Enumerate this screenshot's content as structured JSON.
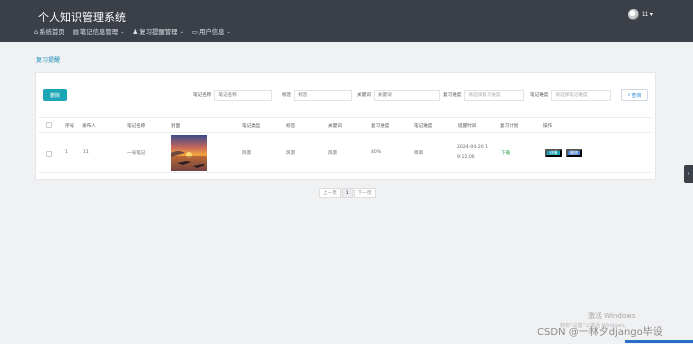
{
  "app": {
    "title": "个人知识管理系统",
    "user": "11 ▾"
  },
  "nav": [
    {
      "icon": "⌂",
      "label": "系统首页",
      "chev": ""
    },
    {
      "icon": "▤",
      "label": "笔记信息管理",
      "chev": "⌄"
    },
    {
      "icon": "♟",
      "label": "复习提醒管理",
      "chev": "⌄"
    },
    {
      "icon": "▭",
      "label": "用户信息",
      "chev": "⌄"
    }
  ],
  "breadcrumb": "复习提醒",
  "toolbar": {
    "delete_label": "删除",
    "query_label": "查询",
    "query_icon": "⌕"
  },
  "filters": {
    "note_name": {
      "label": "笔记名称",
      "placeholder": "笔记名称"
    },
    "tag": {
      "label": "标签",
      "placeholder": "标签"
    },
    "keyword": {
      "label": "关键词",
      "placeholder": "关键词"
    },
    "progress": {
      "label": "复习进度",
      "placeholder": "请选择复习进度"
    },
    "difficulty": {
      "label": "笔记难度",
      "placeholder": "请选择笔记难度"
    }
  },
  "table": {
    "headers": [
      "序号",
      "发布人",
      "笔记名称",
      "封面",
      "笔记类型",
      "标签",
      "关键词",
      "复习进度",
      "笔记难度",
      "提醒时间",
      "复习计划",
      "操作"
    ],
    "rows": [
      {
        "index": "1",
        "publisher": "11",
        "note_name": "一号笔记",
        "type": "风景",
        "tag": "风景",
        "keyword": "风景",
        "progress": "40%",
        "difficulty": "简单",
        "remind_time_1": "2024-04-20 1",
        "remind_time_2": "9:12:06",
        "plan": "下载",
        "detail_label": "详情",
        "delete_label": "删除"
      }
    ]
  },
  "pagination": {
    "prev": "上一页",
    "current": "1",
    "next": "下一页"
  },
  "side_tab": "‹",
  "overlay": {
    "activate": "激活 Windows",
    "activate_sub": "转到“设置”以激活 Windows。",
    "csdn": "CSDN @一林夕django毕设"
  },
  "colors": {
    "topbar": "#3a3f48",
    "accent": "#1aa6b7",
    "link": "#1a8fbf",
    "delete_row": "#4e87d4",
    "plan_link": "#2aa34a"
  }
}
